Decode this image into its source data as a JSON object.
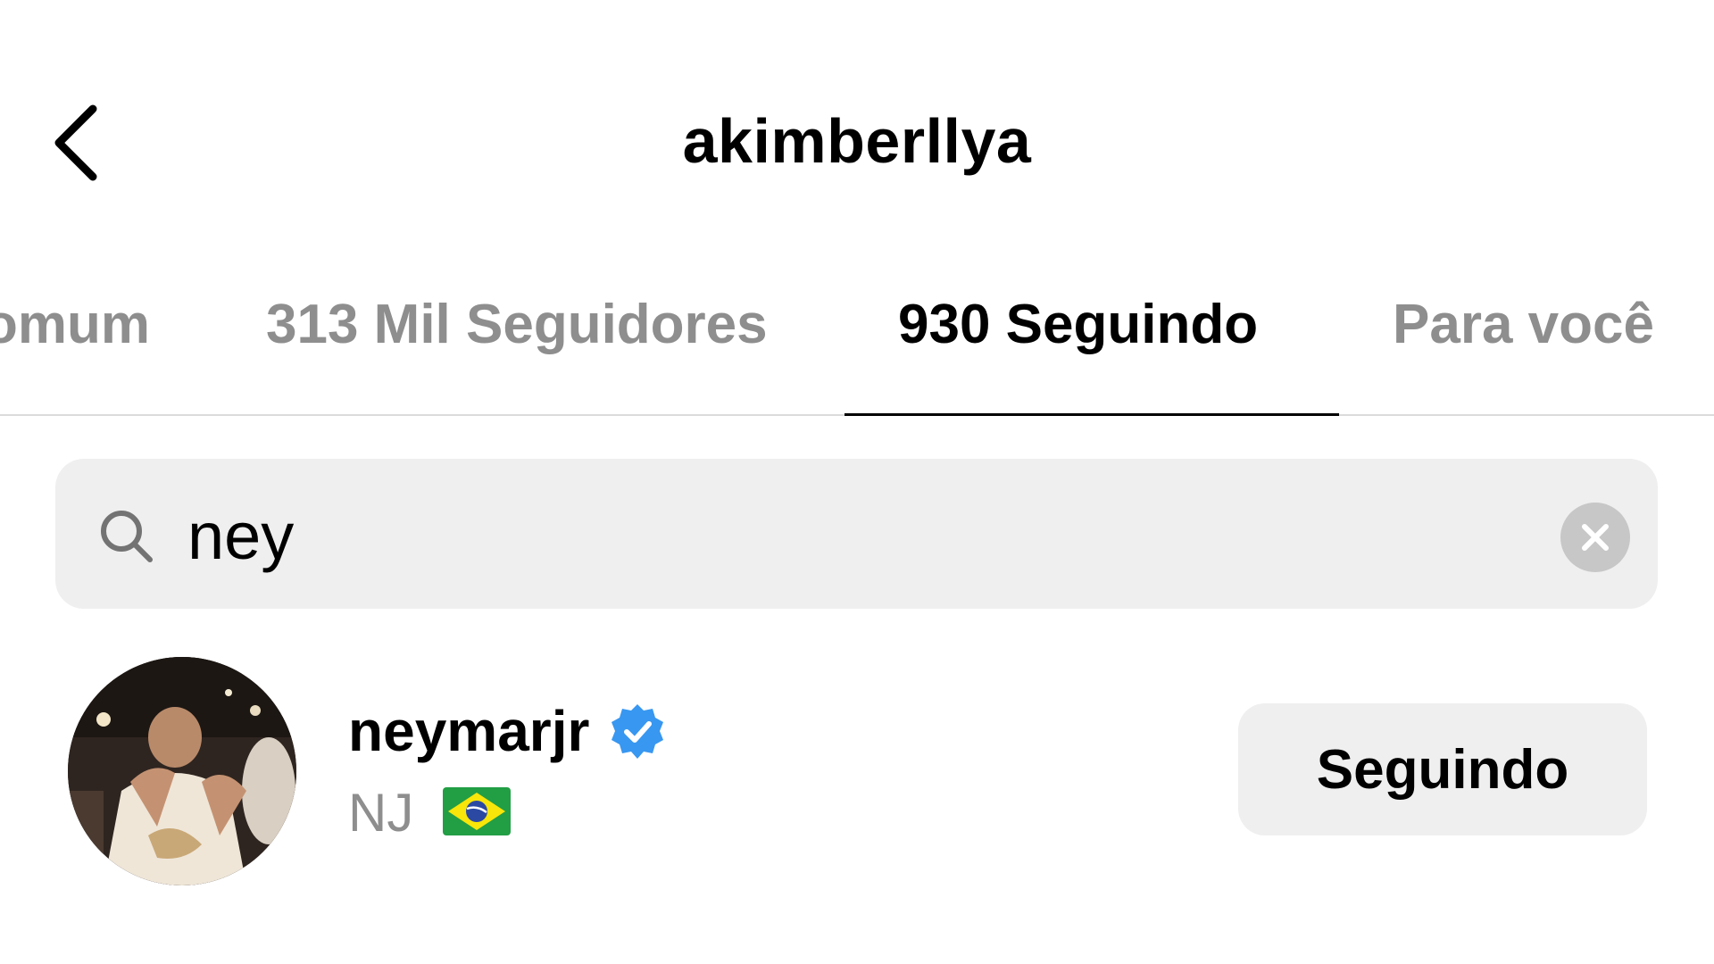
{
  "header": {
    "title": "akimberllya",
    "back_icon": "chevron-left-icon"
  },
  "tabs": [
    {
      "label": "omum",
      "active": false
    },
    {
      "label": "313 Mil Seguidores",
      "active": false
    },
    {
      "label": "930 Seguindo",
      "active": true
    },
    {
      "label": "Para você",
      "active": false
    }
  ],
  "search": {
    "icon": "search-icon",
    "value": "ney",
    "clear_icon": "clear-circle-icon"
  },
  "results": [
    {
      "username": "neymarjr",
      "verified": true,
      "verified_color": "#3897f0",
      "full_name": "NJ",
      "flag_icon": "brazil-flag-icon",
      "button_label": "Seguindo"
    }
  ]
}
